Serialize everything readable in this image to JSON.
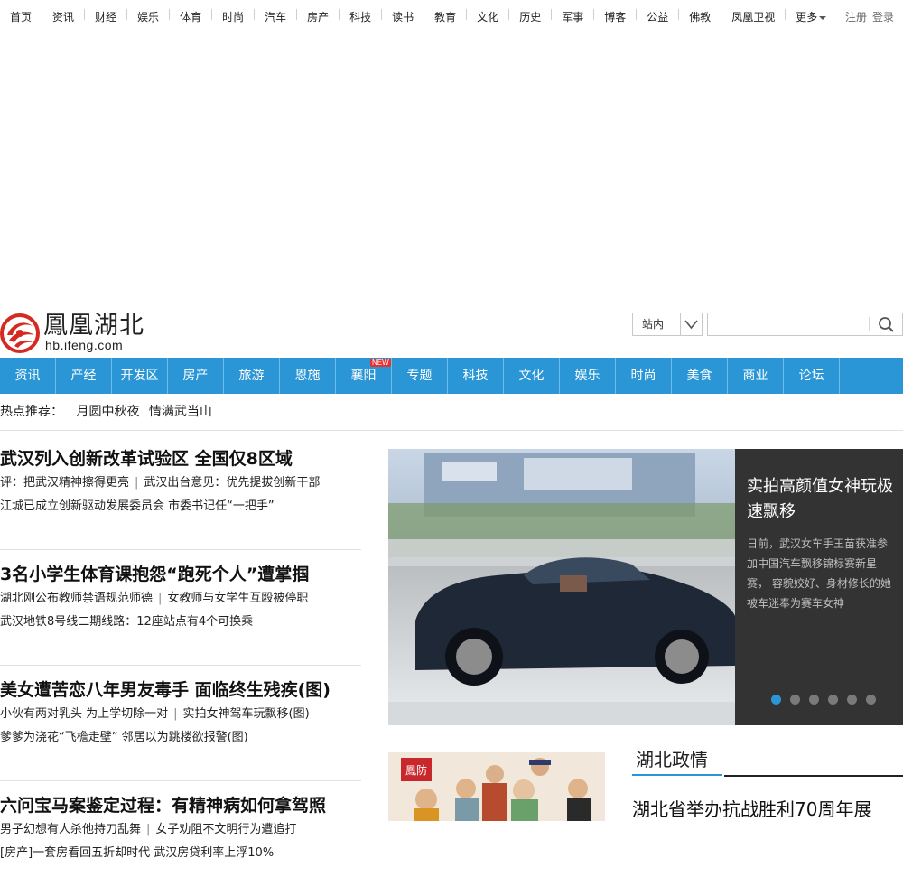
{
  "top_nav": {
    "items": [
      "首页",
      "资讯",
      "财经",
      "娱乐",
      "体育",
      "时尚",
      "汽车",
      "房产",
      "科技",
      "读书",
      "教育",
      "文化",
      "历史",
      "军事",
      "博客",
      "公益",
      "佛教",
      "凤凰卫视"
    ],
    "more_label": "更多",
    "register": "注册",
    "login": "登录"
  },
  "logo": {
    "title": "鳳凰湖北",
    "domain": "hb.ifeng.com"
  },
  "search": {
    "scope_label": "站内",
    "placeholder": ""
  },
  "channel_nav": {
    "items": [
      "资讯",
      "产经",
      "开发区",
      "房产",
      "旅游",
      "恩施",
      "襄阳",
      "专题",
      "科技",
      "文化",
      "娱乐",
      "时尚",
      "美食",
      "商业",
      "论坛"
    ],
    "new_badge": "NEW"
  },
  "hot": {
    "label": "热点推荐：",
    "items": [
      "月圆中秋夜",
      "情满武当山"
    ]
  },
  "headlines": [
    {
      "title": "武汉列入创新改革试验区 全国仅8区域",
      "lines": [
        [
          "评：把武汉精神擦得更亮",
          "武汉出台意见：优先提拔创新干部"
        ],
        [
          "江城已成立创新驱动发展委员会 市委书记任“一把手”"
        ]
      ]
    },
    {
      "title": "3名小学生体育课抱怨“跑死个人”遭掌掴",
      "lines": [
        [
          "湖北刚公布教师禁语规范师德",
          "女教师与女学生互殴被停职"
        ],
        [
          "武汉地铁8号线二期线路：12座站点有4个可换乘"
        ]
      ]
    },
    {
      "title": "美女遭苦恋八年男友毒手 面临终生残疾(图)",
      "lines": [
        [
          "小伙有两对乳头 为上学切除一对",
          "实拍女神驾车玩飘移(图)"
        ],
        [
          "爹爹为浇花“飞檐走壁” 邻居以为跳楼欲报警(图)"
        ]
      ]
    },
    {
      "title": "六问宝马案鉴定过程：有精神病如何拿驾照",
      "lines": [
        [
          "男子幻想有人杀他持刀乱舞",
          "女子劝阻不文明行为遭追打"
        ],
        [
          "[房产]一套房看回五折却时代 武汉房贷利率上浮10%"
        ]
      ]
    }
  ],
  "slideshow": {
    "title": "实拍高颜值女神玩极速飘移",
    "body": "日前，武汉女车手王苗获准参加中国汽车飘移锦标赛新星赛， 容貌姣好、身材修长的她被车迷奉为赛车女神",
    "dot_count": 6,
    "active_index": 0,
    "active_color": "#2a96d6"
  },
  "thumb": {
    "stamp": "鳳防"
  },
  "politics": {
    "tab": "湖北政情",
    "headline": "湖北省举办抗战胜利70周年展"
  },
  "colors": {
    "brand_blue": "#2a96d6",
    "caption_bg": "#333333",
    "logo_red": "#d52a22"
  }
}
